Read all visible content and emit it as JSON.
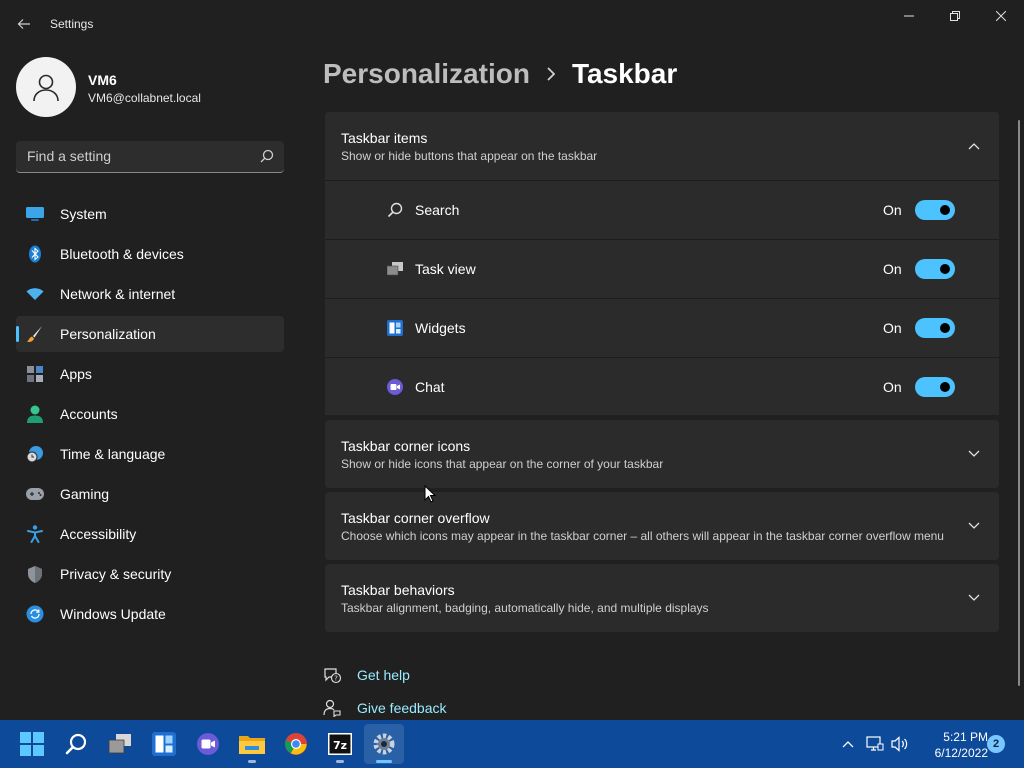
{
  "window": {
    "title": "Settings"
  },
  "profile": {
    "name": "VM6",
    "email": "VM6@collabnet.local"
  },
  "search": {
    "placeholder": "Find a setting"
  },
  "nav": {
    "items": [
      {
        "label": "System",
        "icon": "monitor-icon"
      },
      {
        "label": "Bluetooth & devices",
        "icon": "bluetooth-icon"
      },
      {
        "label": "Network & internet",
        "icon": "wifi-icon"
      },
      {
        "label": "Personalization",
        "icon": "brush-icon",
        "selected": true
      },
      {
        "label": "Apps",
        "icon": "apps-icon"
      },
      {
        "label": "Accounts",
        "icon": "person-icon"
      },
      {
        "label": "Time & language",
        "icon": "clock-globe-icon"
      },
      {
        "label": "Gaming",
        "icon": "gamepad-icon"
      },
      {
        "label": "Accessibility",
        "icon": "accessibility-icon"
      },
      {
        "label": "Privacy & security",
        "icon": "shield-icon"
      },
      {
        "label": "Windows Update",
        "icon": "update-icon"
      }
    ]
  },
  "breadcrumb": {
    "parent": "Personalization",
    "current": "Taskbar"
  },
  "sections": {
    "taskbar_items": {
      "title": "Taskbar items",
      "subtitle": "Show or hide buttons that appear on the taskbar",
      "expanded": true,
      "items": [
        {
          "label": "Search",
          "state": "On",
          "icon": "search-icon"
        },
        {
          "label": "Task view",
          "state": "On",
          "icon": "task-view-icon"
        },
        {
          "label": "Widgets",
          "state": "On",
          "icon": "widgets-icon"
        },
        {
          "label": "Chat",
          "state": "On",
          "icon": "chat-icon"
        }
      ]
    },
    "corner_icons": {
      "title": "Taskbar corner icons",
      "subtitle": "Show or hide icons that appear on the corner of your taskbar"
    },
    "corner_overflow": {
      "title": "Taskbar corner overflow",
      "subtitle": "Choose which icons may appear in the taskbar corner – all others will appear in the taskbar corner overflow menu"
    },
    "behaviors": {
      "title": "Taskbar behaviors",
      "subtitle": "Taskbar alignment, badging, automatically hide, and multiple displays"
    }
  },
  "links": {
    "help": "Get help",
    "feedback": "Give feedback"
  },
  "taskbar": {
    "apps": [
      "start-icon",
      "search-icon",
      "task-view-icon",
      "widgets-icon",
      "chat-icon",
      "file-explorer-icon",
      "chrome-icon",
      "7zip-icon",
      "settings-icon"
    ],
    "time": "5:21 PM",
    "date": "6/12/2022",
    "notifications": "2"
  },
  "colors": {
    "accent": "#4cc2ff",
    "link": "#99ebff",
    "taskbar": "#0d4a9a",
    "background": "#202020",
    "card": "#2b2b2b"
  }
}
